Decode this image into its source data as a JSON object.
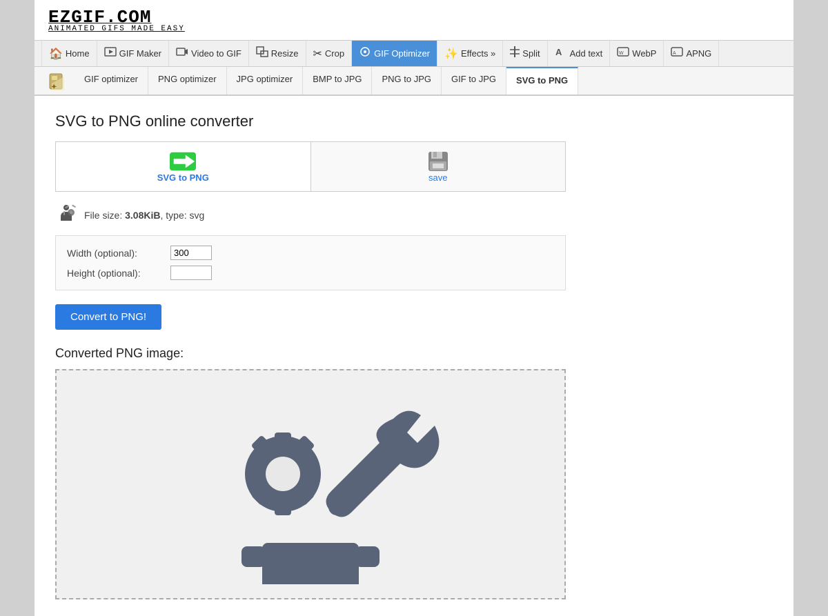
{
  "site": {
    "logo_main": "EZGIF.COM",
    "logo_sub": "ANIMATED GIFS MADE EASY"
  },
  "nav": {
    "items": [
      {
        "id": "home",
        "label": "Home",
        "icon": "🏠",
        "active": false
      },
      {
        "id": "gif-maker",
        "label": "GIF Maker",
        "icon": "🎬",
        "active": false
      },
      {
        "id": "video-to-gif",
        "label": "Video to GIF",
        "icon": "📹",
        "active": false
      },
      {
        "id": "resize",
        "label": "Resize",
        "icon": "🖼",
        "active": false
      },
      {
        "id": "crop",
        "label": "Crop",
        "icon": "✂",
        "active": false
      },
      {
        "id": "gif-optimizer",
        "label": "GIF Optimizer",
        "icon": "⚙",
        "active": true
      },
      {
        "id": "effects",
        "label": "Effects »",
        "icon": "✨",
        "active": false
      },
      {
        "id": "split",
        "label": "Split",
        "icon": "🔪",
        "active": false
      },
      {
        "id": "add-text",
        "label": "Add text",
        "icon": "🅰",
        "active": false
      },
      {
        "id": "webp",
        "label": "WebP",
        "icon": "🌐",
        "active": false
      },
      {
        "id": "apng",
        "label": "APNG",
        "icon": "📌",
        "active": false
      }
    ]
  },
  "subnav": {
    "items": [
      {
        "id": "gif-optimizer",
        "label": "GIF optimizer",
        "active": false
      },
      {
        "id": "png-optimizer",
        "label": "PNG optimizer",
        "active": false
      },
      {
        "id": "jpg-optimizer",
        "label": "JPG optimizer",
        "active": false
      },
      {
        "id": "bmp-to-jpg",
        "label": "BMP to JPG",
        "active": false
      },
      {
        "id": "png-to-jpg",
        "label": "PNG to JPG",
        "active": false
      },
      {
        "id": "gif-to-jpg",
        "label": "GIF to JPG",
        "active": false
      },
      {
        "id": "svg-to-png",
        "label": "SVG to PNG",
        "active": true
      }
    ]
  },
  "page": {
    "title": "SVG to PNG online converter",
    "tab_svg_label": "SVG to PNG",
    "tab_save_label": "save",
    "file_size_label": "File size: ",
    "file_size_value": "3.08KiB",
    "file_type_label": ", type: svg",
    "width_label": "Width (optional):",
    "height_label": "Height (optional):",
    "width_value": "300",
    "height_value": "",
    "convert_button": "Convert to PNG!",
    "converted_label": "Converted PNG image:"
  }
}
